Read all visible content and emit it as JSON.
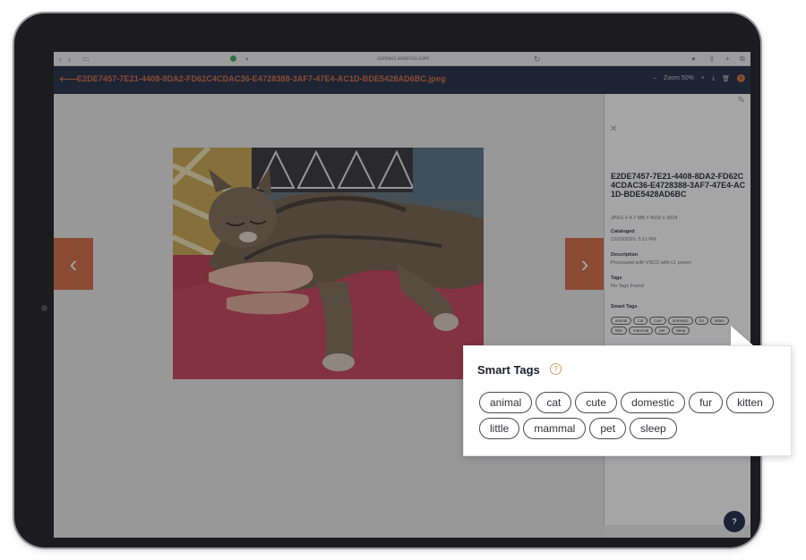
{
  "browser": {
    "url": "connect.extensis.com"
  },
  "header": {
    "file_name": "E2DE7457-7E21-4408-8DA2-FD62C4CDAC36-E4728388-3AF7-47E4-AC1D-BDE5428AD6BC.jpeg",
    "zoom_minus": "–",
    "zoom_label": "Zoom 50%",
    "zoom_plus": "+"
  },
  "panel": {
    "title": "E2DE7457-7E21-4408-8DA2-FD62C4CDAC36-E4728388-3AF7-47E4-AC1D-BDE5428AD6BC",
    "meta": "JPEG // 4.7 MB // 4032 x 3024",
    "cataloged_label": "Cataloged",
    "cataloged_value": "12/20/2020, 5:11 PM",
    "description_label": "Description",
    "description_value": "Processed with VSCO with c1 preset",
    "tags_label": "Tags",
    "tags_value": "No Tags Found",
    "smart_tags_label": "Smart Tags",
    "smart_tags": [
      "animal",
      "cat",
      "cute",
      "domestic",
      "fur",
      "kitten",
      "little",
      "mammal",
      "pet",
      "sleep"
    ]
  },
  "callout": {
    "title": "Smart Tags",
    "help": "?",
    "row1": [
      "animal",
      "cat",
      "cute",
      "domestic",
      "fur",
      "kitten"
    ],
    "row2": [
      "little",
      "mammal",
      "pet",
      "sleep"
    ]
  },
  "icons": {
    "back": "back-arrow-icon",
    "prev": "chevron-left-icon",
    "next": "chevron-right-icon",
    "close": "close-icon",
    "edit": "pencil-icon",
    "download": "download-icon",
    "delete": "trash-icon",
    "info": "info-icon",
    "help": "help-icon"
  },
  "colors": {
    "accent": "#d2663a",
    "header_bg": "#17223a"
  }
}
